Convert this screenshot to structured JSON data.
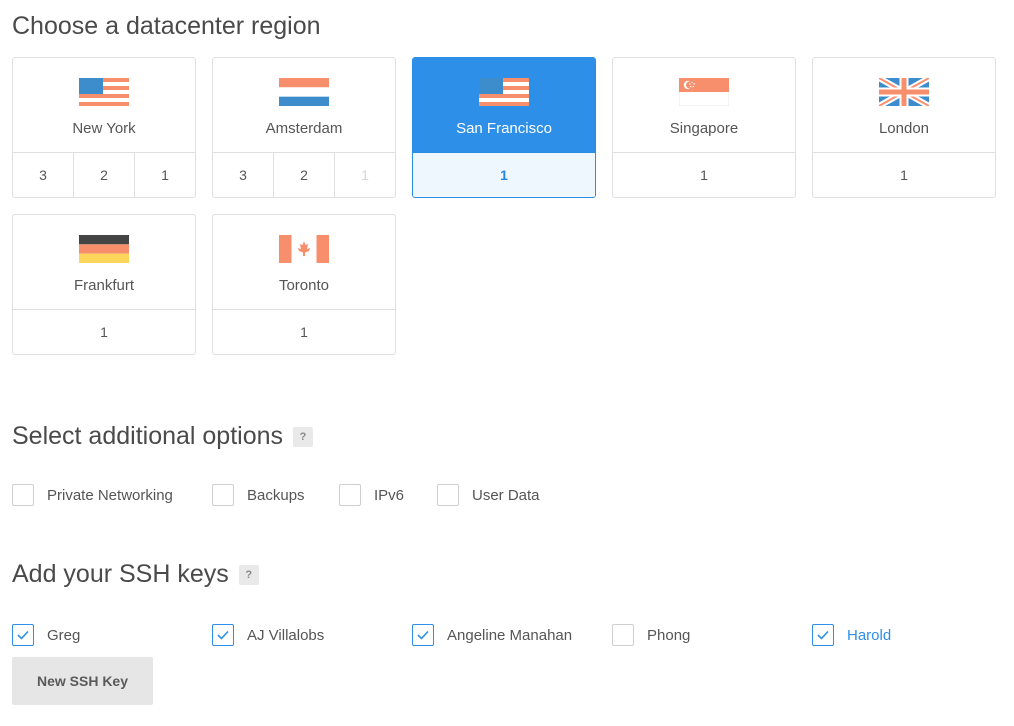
{
  "region_section": {
    "title": "Choose a datacenter region",
    "regions": [
      {
        "name": "New York",
        "flag": "us-flag-icon",
        "datacenters": [
          "3",
          "2",
          "1"
        ],
        "disabled": [
          false,
          false,
          false
        ],
        "selected": false
      },
      {
        "name": "Amsterdam",
        "flag": "nl-flag-icon",
        "datacenters": [
          "3",
          "2",
          "1"
        ],
        "disabled": [
          false,
          false,
          true
        ],
        "selected": false
      },
      {
        "name": "San Francisco",
        "flag": "us-flag-icon",
        "datacenters": [
          "1"
        ],
        "disabled": [
          false
        ],
        "selected": true
      },
      {
        "name": "Singapore",
        "flag": "sg-flag-icon",
        "datacenters": [
          "1"
        ],
        "disabled": [
          false
        ],
        "selected": false
      },
      {
        "name": "London",
        "flag": "uk-flag-icon",
        "datacenters": [
          "1"
        ],
        "disabled": [
          false
        ],
        "selected": false
      },
      {
        "name": "Frankfurt",
        "flag": "de-flag-icon",
        "datacenters": [
          "1"
        ],
        "disabled": [
          false
        ],
        "selected": false
      },
      {
        "name": "Toronto",
        "flag": "ca-flag-icon",
        "datacenters": [
          "1"
        ],
        "disabled": [
          false
        ],
        "selected": false
      }
    ]
  },
  "options_section": {
    "title": "Select additional options",
    "help": "?",
    "options": [
      {
        "label": "Private Networking",
        "checked": false
      },
      {
        "label": "Backups",
        "checked": false
      },
      {
        "label": "IPv6",
        "checked": false
      },
      {
        "label": "User Data",
        "checked": false
      }
    ]
  },
  "ssh_section": {
    "title": "Add your SSH keys",
    "help": "?",
    "keys": [
      {
        "label": "Greg",
        "checked": true
      },
      {
        "label": "AJ Villalobs",
        "checked": true
      },
      {
        "label": "Angeline Manahan",
        "checked": true
      },
      {
        "label": "Phong",
        "checked": false
      },
      {
        "label": "Harold",
        "checked": true
      }
    ],
    "new_key_label": "New SSH Key"
  },
  "colors": {
    "accent": "#2d8fe7",
    "selected_footer": "#eef6fe",
    "border": "#dfdfdf",
    "flag_blue": "#3d8ccc",
    "flag_salmon": "#f78f6c"
  }
}
